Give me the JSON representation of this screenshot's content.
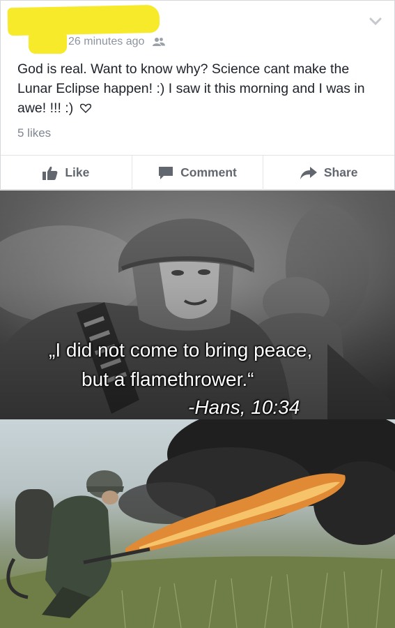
{
  "post": {
    "timestamp": "26 minutes ago",
    "audience_icon": "friends-icon",
    "text": "God is real. Want to know why? Science cant make the Lunar Eclipse happen! :) I saw it this morning and I was in awe! !!! :)",
    "likes": "5 likes",
    "actions": [
      {
        "label": "Like",
        "icon": "thumbs-up-icon"
      },
      {
        "label": "Comment",
        "icon": "comment-icon"
      },
      {
        "label": "Share",
        "icon": "share-arrow-icon"
      }
    ]
  },
  "meme": {
    "quote_line1": "„I did not come to bring peace,",
    "quote_line2": "but a flamethrower.“",
    "attribution": "-Hans, 10:34"
  },
  "colors": {
    "redaction": "#f6ea2a",
    "text_dark": "#1d2129",
    "text_gray": "#62676f"
  }
}
